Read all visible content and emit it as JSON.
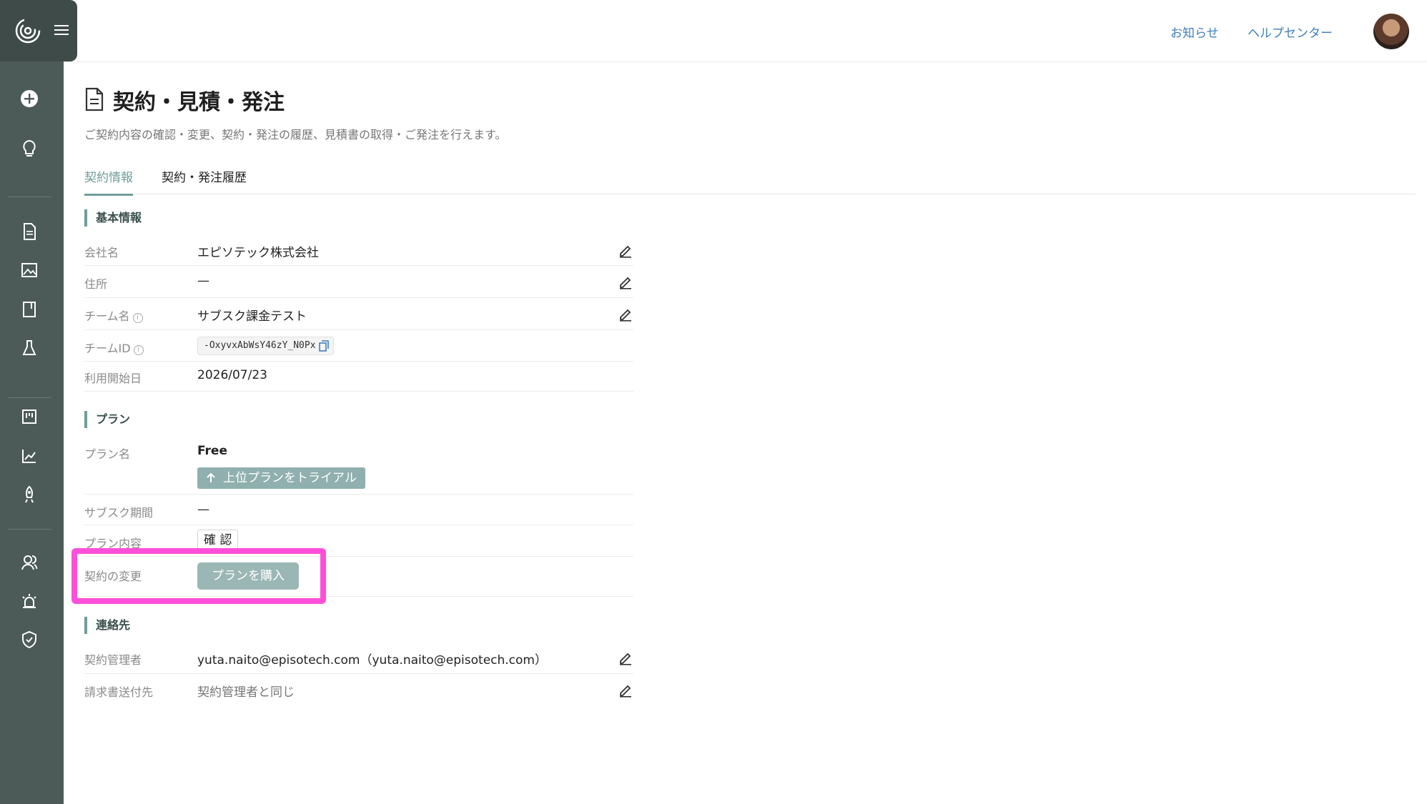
{
  "header": {
    "notice_link": "お知らせ",
    "help_link": "ヘルプセンター"
  },
  "page": {
    "title": "契約・見積・発注",
    "description": "ご契約内容の確認・変更、契約・発注の履歴、見積書の取得・ご発注を行えます。"
  },
  "tabs": [
    {
      "label": "契約情報",
      "active": true
    },
    {
      "label": "契約・発注履歴",
      "active": false
    }
  ],
  "basic": {
    "heading": "基本情報",
    "company_label": "会社名",
    "company_value": "エピソテック株式会社",
    "address_label": "住所",
    "address_value": "—",
    "team_name_label": "チーム名",
    "team_name_value": "サブスク課金テスト",
    "team_id_label": "チームID",
    "team_id_value": "-OxyvxAbWsY46zY_N0Px",
    "start_date_label": "利用開始日",
    "start_date_value": "2026/07/23"
  },
  "plan": {
    "heading": "プラン",
    "plan_name_label": "プラン名",
    "plan_name_value": "Free",
    "trial_button": "上位プランをトライアル",
    "period_label": "サブスク期間",
    "period_value": "—",
    "content_label": "プラン内容",
    "content_button": "確 認",
    "change_label": "契約の変更",
    "buy_button": "プランを購入"
  },
  "contact": {
    "heading": "連絡先",
    "manager_label": "契約管理者",
    "manager_value": "yuta.naito@episotech.com（yuta.naito@episotech.com）",
    "billing_label": "請求書送付先",
    "billing_value": "契約管理者と同じ"
  },
  "colors": {
    "sidebar": "#4c5b58",
    "accent": "#6f9d9b",
    "link": "#3f7fc1",
    "highlight": "#ff4fd8"
  }
}
